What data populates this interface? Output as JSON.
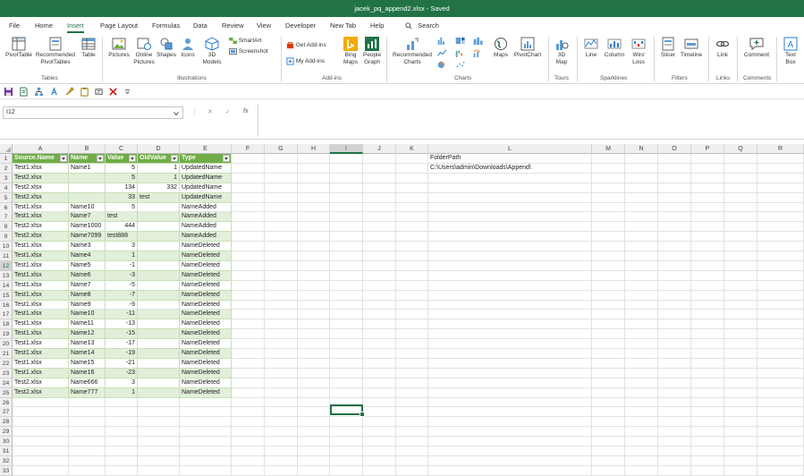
{
  "titlebar": {
    "title": "jacek_pq_append2.xlsx  -  Saved"
  },
  "menu": [
    "File",
    "Home",
    "Insert",
    "Page Layout",
    "Formulas",
    "Data",
    "Review",
    "View",
    "Developer",
    "New Tab",
    "Help",
    "Search"
  ],
  "ribbon": {
    "tables": {
      "pivottable": "PivotTable",
      "recommended_pivot_1": "Recommended",
      "recommended_pivot_2": "PivotTables",
      "table": "Table",
      "group": "Tables"
    },
    "illustrations": {
      "pictures": "Pictures",
      "online_pictures_1": "Online",
      "online_pictures_2": "Pictures",
      "shapes": "Shapes",
      "icons": "Icons",
      "models_1": "3D",
      "models_2": "Models",
      "smartart": "SmartArt",
      "screenshot": "Screenshot",
      "group": "Illustrations"
    },
    "addins": {
      "get_addins": "Get Add-ins",
      "my_addins": "My Add-ins",
      "bing_1": "Bing",
      "bing_2": "Maps",
      "people_1": "People",
      "people_2": "Graph",
      "group": "Add-ins"
    },
    "charts": {
      "recommended_1": "Recommended",
      "recommended_2": "Charts",
      "maps": "Maps",
      "pivotchart": "PivotChart",
      "group": "Charts"
    },
    "tours": {
      "map_1": "3D",
      "map_2": "Map",
      "group": "Tours"
    },
    "sparklines": {
      "line": "Line",
      "column": "Column",
      "winloss_1": "Win/",
      "winloss_2": "Loss",
      "group": "Sparklines"
    },
    "filters": {
      "slicer": "Slicer",
      "timeline": "Timeline",
      "group": "Filters"
    },
    "links": {
      "link": "Link",
      "group": "Links"
    },
    "comments": {
      "comment": "Comment",
      "group": "Comments"
    },
    "text": {
      "textbox_1": "Text",
      "textbox_2": "Box"
    }
  },
  "formula_bar": {
    "name_box": "I12",
    "formula": ""
  },
  "columns": [
    "A",
    "B",
    "C",
    "D",
    "E",
    "F",
    "G",
    "H",
    "I",
    "J",
    "K",
    "L",
    "M",
    "N",
    "O",
    "P",
    "Q",
    "R"
  ],
  "selected_column": "I",
  "selected_row": "12",
  "rows": [
    "1",
    "2",
    "3",
    "4",
    "5",
    "6",
    "7",
    "8",
    "9",
    "10",
    "11",
    "12",
    "13",
    "14",
    "15",
    "16",
    "17",
    "18",
    "19",
    "20",
    "21",
    "22",
    "23",
    "24",
    "25",
    "26",
    "27",
    "28",
    "29",
    "30",
    "31",
    "32",
    "33"
  ],
  "table": {
    "headers": [
      "Source.Name",
      "Name",
      "Value",
      "OldValue",
      "Type"
    ],
    "rows": [
      [
        "Test1.xlsx",
        "Name1",
        "5",
        "1",
        "UpdatedName"
      ],
      [
        "Test2.xlsx",
        "",
        "5",
        "1",
        "UpdatedName"
      ],
      [
        "Test2.xlsx",
        "",
        "134",
        "332",
        "UpdatedName"
      ],
      [
        "Test2.xlsx",
        "",
        "33",
        "test",
        "UpdatedName"
      ],
      [
        "Test1.xlsx",
        "Name10",
        "5",
        "",
        "NameAdded"
      ],
      [
        "Test1.xlsx",
        "Name7",
        "test",
        "",
        "NameAdded"
      ],
      [
        "Test2.xlsx",
        "Name1000",
        "444",
        "",
        "NameAdded"
      ],
      [
        "Test2.xlsx",
        "Name7099",
        "test888",
        "",
        "NameAdded"
      ],
      [
        "Test1.xlsx",
        "Name3",
        "3",
        "",
        "NameDeleted"
      ],
      [
        "Test1.xlsx",
        "Name4",
        "1",
        "",
        "NameDeleted"
      ],
      [
        "Test1.xlsx",
        "Name5",
        "-1",
        "",
        "NameDeleted"
      ],
      [
        "Test1.xlsx",
        "Name6",
        "-3",
        "",
        "NameDeleted"
      ],
      [
        "Test1.xlsx",
        "Name7",
        "-5",
        "",
        "NameDeleted"
      ],
      [
        "Test1.xlsx",
        "Name8",
        "-7",
        "",
        "NameDeleted"
      ],
      [
        "Test1.xlsx",
        "Name9",
        "-9",
        "",
        "NameDeleted"
      ],
      [
        "Test1.xlsx",
        "Name10",
        "-11",
        "",
        "NameDeleted"
      ],
      [
        "Test1.xlsx",
        "Name11",
        "-13",
        "",
        "NameDeleted"
      ],
      [
        "Test1.xlsx",
        "Name12",
        "-15",
        "",
        "NameDeleted"
      ],
      [
        "Test1.xlsx",
        "Name13",
        "-17",
        "",
        "NameDeleted"
      ],
      [
        "Test1.xlsx",
        "Name14",
        "-19",
        "",
        "NameDeleted"
      ],
      [
        "Test1.xlsx",
        "Name15",
        "-21",
        "",
        "NameDeleted"
      ],
      [
        "Test1.xlsx",
        "Name16",
        "-23",
        "",
        "NameDeleted"
      ],
      [
        "Test2.xlsx",
        "Name666",
        "3",
        "",
        "NameDeleted"
      ],
      [
        "Test2.xlsx",
        "Name777",
        "1",
        "",
        "NameDeleted"
      ]
    ]
  },
  "folder": {
    "label": "FolderPath",
    "path": "C:\\Users\\admin\\Downloads\\Append\\"
  },
  "colors": {
    "brand": "#217346",
    "table_header": "#70ad47",
    "table_band": "#e2efda"
  }
}
